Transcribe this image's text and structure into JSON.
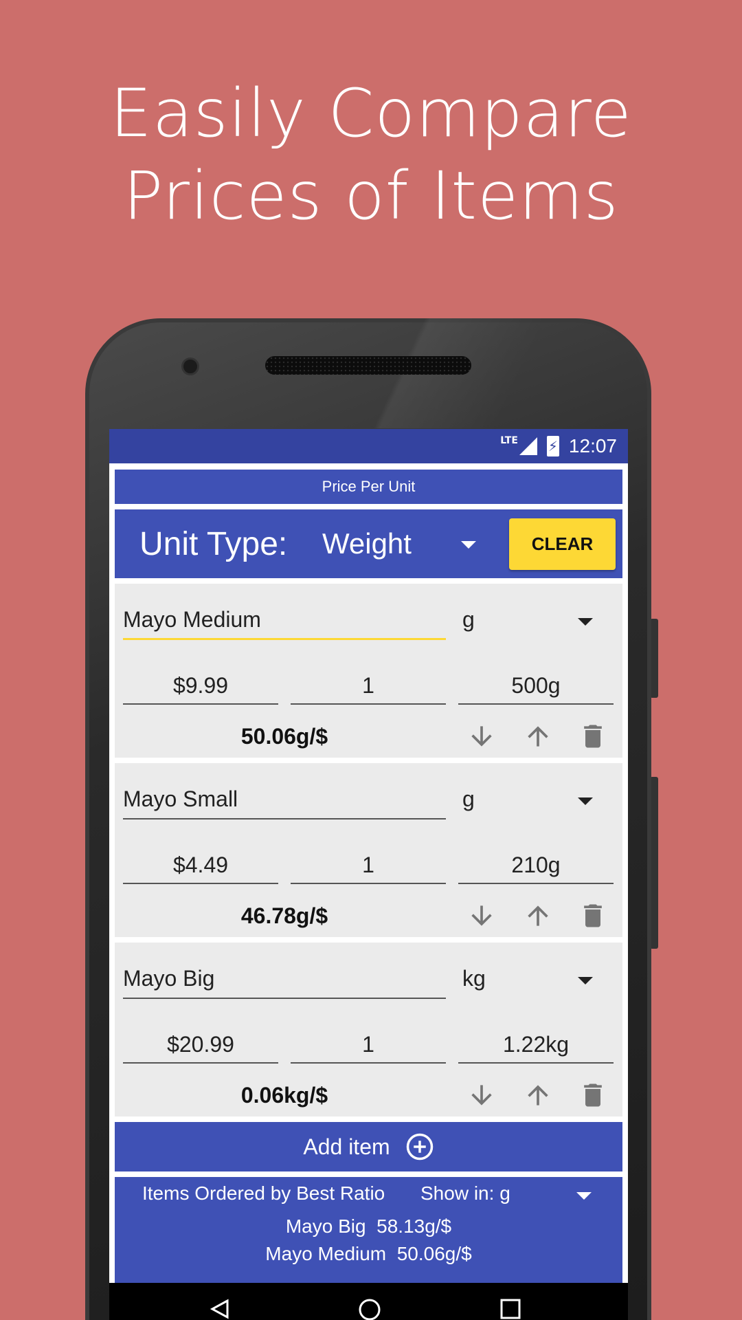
{
  "headline": {
    "line1": "Easily Compare",
    "line2": "Prices of Items"
  },
  "status": {
    "network": "LTE",
    "time": "12:07"
  },
  "app": {
    "title": "Price Per Unit",
    "unit_type_label": "Unit Type:",
    "unit_type_value": "Weight",
    "clear_label": "CLEAR"
  },
  "items": [
    {
      "name": "Mayo Medium",
      "unit": "g",
      "price": "$9.99",
      "qty": "1",
      "amount": "500g",
      "ratio": "50.06g/$"
    },
    {
      "name": "Mayo Small",
      "unit": "g",
      "price": "$4.49",
      "qty": "1",
      "amount": "210g",
      "ratio": "46.78g/$"
    },
    {
      "name": "Mayo Big",
      "unit": "kg",
      "price": "$20.99",
      "qty": "1",
      "amount": "1.22kg",
      "ratio": "0.06kg/$"
    }
  ],
  "add_item_label": "Add item",
  "results": {
    "title": "Items Ordered by Best Ratio",
    "show_in_label": "Show in:",
    "show_in_value": "g",
    "rows": [
      {
        "name": "Mayo Big",
        "ratio": "58.13g/$"
      },
      {
        "name": "Mayo Medium",
        "ratio": "50.06g/$"
      }
    ]
  },
  "colors": {
    "background": "#cc6e6b",
    "primary": "#3f51b5",
    "accent": "#fdd835"
  },
  "icons": [
    "arrow-down-icon",
    "arrow-up-icon",
    "trash-icon",
    "add-circle-icon",
    "back-icon",
    "home-icon",
    "recents-icon"
  ]
}
